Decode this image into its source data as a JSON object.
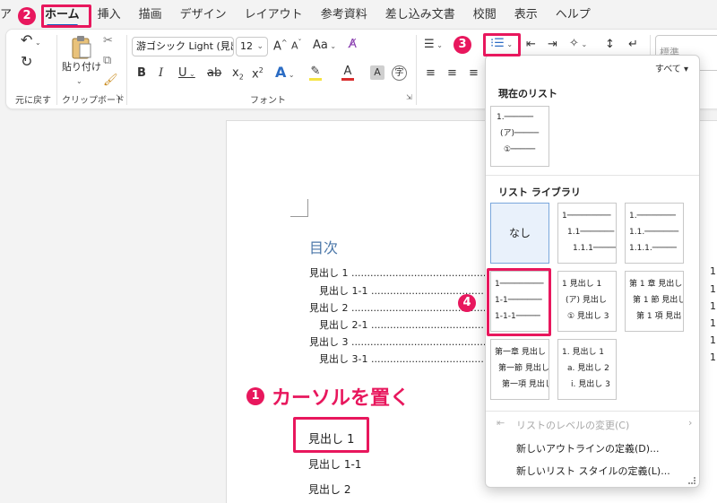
{
  "menu": {
    "cut_tab": "ア",
    "tabs": [
      "ホーム",
      "挿入",
      "描画",
      "デザイン",
      "レイアウト",
      "参考資料",
      "差し込み文書",
      "校閲",
      "表示",
      "ヘルプ"
    ]
  },
  "ribbon": {
    "undo_group_label": "元に戻す",
    "paste_label": "貼り付け",
    "clipboard_group_label": "クリップボード",
    "font_name": "游ゴシック Light (見出し",
    "font_size": "12",
    "font_group_label": "フォント",
    "case_button": "Aa",
    "style_cut": "標準"
  },
  "document": {
    "toc_title": "目次",
    "toc_entries": [
      {
        "label": "見出し 1",
        "indent": false,
        "page": "1"
      },
      {
        "label": "見出し 1-1",
        "indent": true,
        "page": "1"
      },
      {
        "label": "見出し 2",
        "indent": false,
        "page": "1"
      },
      {
        "label": "見出し 2-1",
        "indent": true,
        "page": "1"
      },
      {
        "label": "見出し 3",
        "indent": false,
        "page": "1"
      },
      {
        "label": "見出し 3-1",
        "indent": true,
        "page": "1"
      }
    ],
    "dots": "................................................................................................",
    "body_headings": [
      "見出し 1",
      "見出し 1-1",
      "見出し 2"
    ]
  },
  "annotations": {
    "step1": "1",
    "step2": "2",
    "step3": "3",
    "step4": "4",
    "callout": "カーソルを置く",
    "accent_color": "#e8175d"
  },
  "panel": {
    "filter_label": "すべて",
    "current_section": "現在のリスト",
    "library_section": "リスト ライブラリ",
    "current_tile": [
      "1.",
      "(ア)",
      "①"
    ],
    "none_label": "なし",
    "tile_b": [
      "1",
      "1.1",
      "1.1.1"
    ],
    "tile_c": [
      "1.",
      "1.1.",
      "1.1.1."
    ],
    "tile_d": [
      "1",
      "1-1",
      "1-1-1"
    ],
    "tile_e": [
      "1 見出し 1",
      "(ア) 見出し",
      "① 見出し 3"
    ],
    "tile_f": [
      "第 1 章 見出し",
      "第 1 節 見出し",
      "第 1 項 見出し"
    ],
    "tile_g": [
      "第一章 見出し",
      "第一節 見出し",
      "第一項 見出し"
    ],
    "tile_h": [
      "1. 見出し 1",
      "a. 見出し 2",
      "i. 見出し 3"
    ],
    "change_level": "リストのレベルの変更(C)",
    "define_multilevel": "新しいアウトラインの定義(D)...",
    "define_style": "新しいリスト スタイルの定義(L)..."
  }
}
